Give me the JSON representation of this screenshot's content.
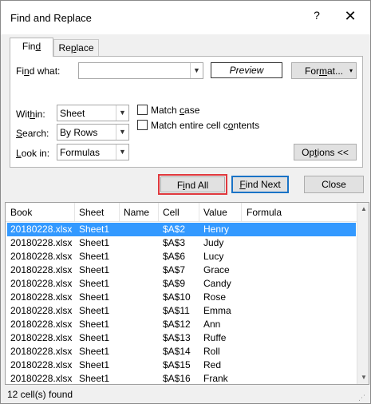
{
  "titlebar": {
    "title": "Find and Replace",
    "help": "?",
    "close": "✕"
  },
  "tabs": [
    {
      "prefix": "Fin",
      "accel": "d",
      "suffix": ""
    },
    {
      "prefix": "Re",
      "accel": "p",
      "suffix": "lace"
    }
  ],
  "find_what": {
    "label_prefix": "Fi",
    "label_accel": "n",
    "label_suffix": "d what:",
    "value": ""
  },
  "preview_label": "Preview",
  "format_button": {
    "prefix": "For",
    "accel": "m",
    "suffix": "at...",
    "arrow": "▾"
  },
  "within": {
    "label_prefix": "Wit",
    "label_accel": "h",
    "label_suffix": "in:",
    "value": "Sheet"
  },
  "search": {
    "label_prefix": "",
    "label_accel": "S",
    "label_suffix": "earch:",
    "value": "By Rows"
  },
  "look_in": {
    "label_prefix": "",
    "label_accel": "L",
    "label_suffix": "ook in:",
    "value": "Formulas"
  },
  "match_case": {
    "prefix": "Match ",
    "accel": "c",
    "suffix": "ase",
    "checked": false
  },
  "match_entire": {
    "prefix": "Match entire cell c",
    "accel": "o",
    "suffix": "ntents",
    "checked": false
  },
  "options_button": {
    "prefix": "Op",
    "accel": "t",
    "suffix": "ions <<"
  },
  "find_all_button": {
    "prefix": "F",
    "accel": "i",
    "suffix": "nd All"
  },
  "find_next_button": {
    "prefix": "",
    "accel": "F",
    "suffix": "ind Next"
  },
  "close_button": "Close",
  "results": {
    "columns": [
      "Book",
      "Sheet",
      "Name",
      "Cell",
      "Value",
      "Formula"
    ],
    "rows": [
      {
        "book": "20180228.xlsx",
        "sheet": "Sheet1",
        "name": "",
        "cell": "$A$2",
        "value": "Henry",
        "formula": ""
      },
      {
        "book": "20180228.xlsx",
        "sheet": "Sheet1",
        "name": "",
        "cell": "$A$3",
        "value": "Judy",
        "formula": ""
      },
      {
        "book": "20180228.xlsx",
        "sheet": "Sheet1",
        "name": "",
        "cell": "$A$6",
        "value": "Lucy",
        "formula": ""
      },
      {
        "book": "20180228.xlsx",
        "sheet": "Sheet1",
        "name": "",
        "cell": "$A$7",
        "value": "Grace",
        "formula": ""
      },
      {
        "book": "20180228.xlsx",
        "sheet": "Sheet1",
        "name": "",
        "cell": "$A$9",
        "value": "Candy",
        "formula": ""
      },
      {
        "book": "20180228.xlsx",
        "sheet": "Sheet1",
        "name": "",
        "cell": "$A$10",
        "value": "Rose",
        "formula": ""
      },
      {
        "book": "20180228.xlsx",
        "sheet": "Sheet1",
        "name": "",
        "cell": "$A$11",
        "value": "Emma",
        "formula": ""
      },
      {
        "book": "20180228.xlsx",
        "sheet": "Sheet1",
        "name": "",
        "cell": "$A$12",
        "value": "Ann",
        "formula": ""
      },
      {
        "book": "20180228.xlsx",
        "sheet": "Sheet1",
        "name": "",
        "cell": "$A$13",
        "value": "Ruffe",
        "formula": ""
      },
      {
        "book": "20180228.xlsx",
        "sheet": "Sheet1",
        "name": "",
        "cell": "$A$14",
        "value": "Roll",
        "formula": ""
      },
      {
        "book": "20180228.xlsx",
        "sheet": "Sheet1",
        "name": "",
        "cell": "$A$15",
        "value": "Red",
        "formula": ""
      },
      {
        "book": "20180228.xlsx",
        "sheet": "Sheet1",
        "name": "",
        "cell": "$A$16",
        "value": "Frank",
        "formula": ""
      }
    ]
  },
  "status": "12 cell(s) found",
  "colors": {
    "selection": "#3399ff",
    "find_all_outline": "#e0393e",
    "focus_border": "#1a73c6"
  }
}
